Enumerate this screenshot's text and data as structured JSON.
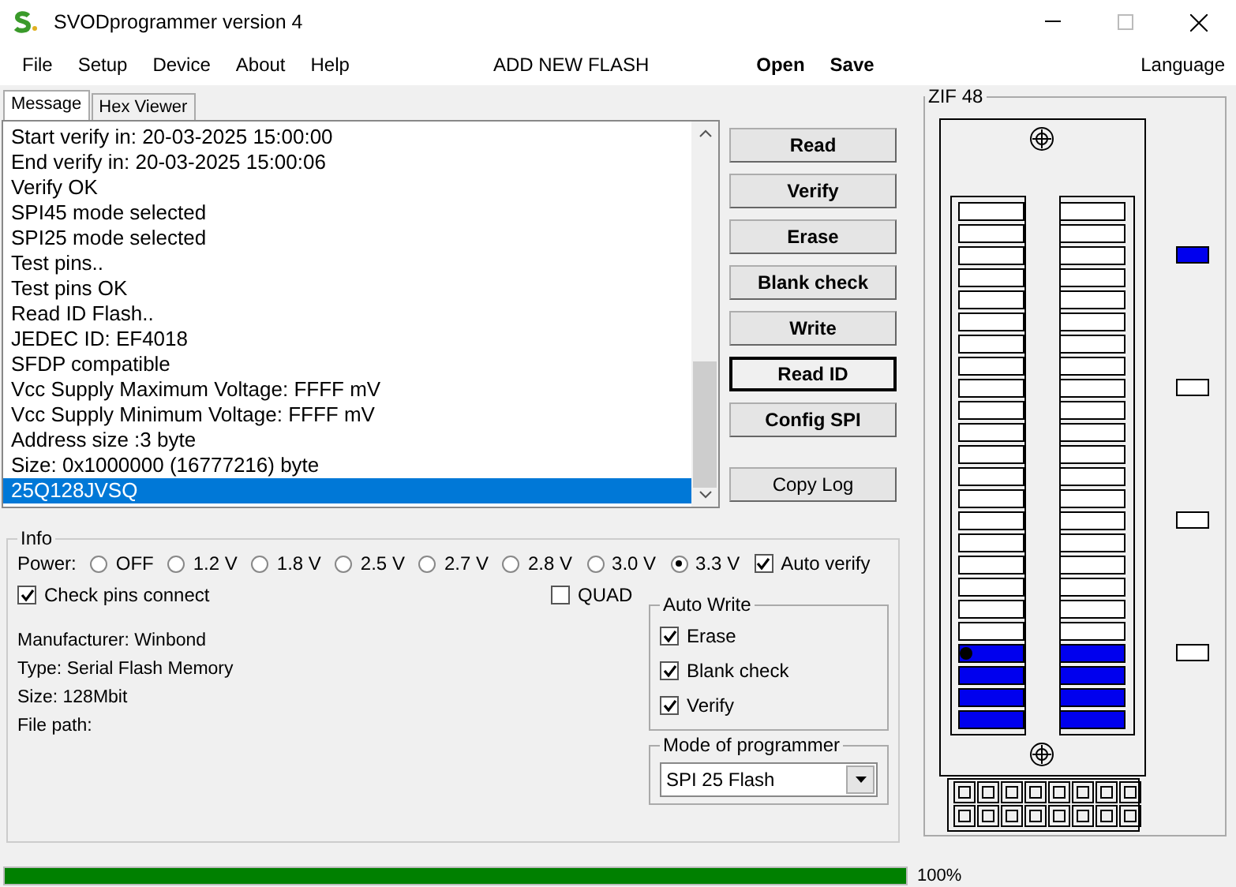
{
  "window": {
    "title": "SVODprogrammer version 4"
  },
  "menu": [
    {
      "label": "File"
    },
    {
      "label": "Setup"
    },
    {
      "label": "Device"
    },
    {
      "label": "About"
    },
    {
      "label": "Help"
    }
  ],
  "toolbar": {
    "add_flash": "ADD NEW FLASH",
    "open": "Open",
    "save": "Save",
    "language": "Language"
  },
  "tabs": [
    {
      "label": "Message",
      "selected": true
    },
    {
      "label": "Hex Viewer",
      "selected": false
    }
  ],
  "log": [
    {
      "text": "Start verify in: 20-03-2025 15:00:00",
      "selected": false
    },
    {
      "text": "End verify in: 20-03-2025 15:00:06",
      "selected": false
    },
    {
      "text": "Verify OK",
      "selected": false
    },
    {
      "text": "SPI45 mode selected",
      "selected": false
    },
    {
      "text": "SPI25 mode selected",
      "selected": false
    },
    {
      "text": "Test pins..",
      "selected": false
    },
    {
      "text": "Test pins OK",
      "selected": false
    },
    {
      "text": "Read ID Flash..",
      "selected": false
    },
    {
      "text": "JEDEC ID: EF4018",
      "selected": false
    },
    {
      "text": "SFDP compatible",
      "selected": false
    },
    {
      "text": "Vcc Supply Maximum Voltage: FFFF mV",
      "selected": false
    },
    {
      "text": "Vcc Supply Minimum Voltage: FFFF mV",
      "selected": false
    },
    {
      "text": "Address size :3 byte",
      "selected": false
    },
    {
      "text": "Size: 0x1000000 (16777216) byte",
      "selected": false
    },
    {
      "text": "25Q128JVSQ",
      "selected": true
    }
  ],
  "buttons": [
    {
      "label": "Read",
      "kind": "action",
      "focused": false
    },
    {
      "label": "Verify",
      "kind": "action",
      "focused": false
    },
    {
      "label": "Erase",
      "kind": "action",
      "focused": false
    },
    {
      "label": "Blank check",
      "kind": "action",
      "focused": false
    },
    {
      "label": "Write",
      "kind": "action",
      "focused": false
    },
    {
      "label": "Read ID",
      "kind": "action",
      "focused": true
    },
    {
      "label": "Config SPI",
      "kind": "action",
      "focused": false
    },
    {
      "label": "Copy Log",
      "kind": "utility",
      "focused": false
    }
  ],
  "info": {
    "title": "Info",
    "power_label": "Power:",
    "power": [
      {
        "label": "OFF",
        "selected": false
      },
      {
        "label": "1.2 V",
        "selected": false
      },
      {
        "label": "1.8 V",
        "selected": false
      },
      {
        "label": "2.5 V",
        "selected": false
      },
      {
        "label": "2.7 V",
        "selected": false
      },
      {
        "label": "2.8 V",
        "selected": false
      },
      {
        "label": "3.0 V",
        "selected": false
      },
      {
        "label": "3.3 V",
        "selected": true
      }
    ],
    "auto_verify": {
      "label": "Auto verify",
      "checked": true
    },
    "check_pins": {
      "label": "Check pins connect",
      "checked": true
    },
    "quad": {
      "label": "QUAD",
      "checked": false
    },
    "details": [
      "Manufacturer: Winbond",
      "Type:  Serial Flash Memory",
      "Size: 128Mbit",
      "File path:"
    ],
    "auto_write": {
      "title": "Auto Write",
      "options": [
        {
          "label": "Erase",
          "checked": true
        },
        {
          "label": "Blank check",
          "checked": true
        },
        {
          "label": "Verify",
          "checked": true
        }
      ]
    },
    "mode": {
      "title": "Mode of programmer",
      "value": "SPI 25 Flash"
    }
  },
  "zif": {
    "title": "ZIF 48",
    "left_pins": [
      {
        "on": false
      },
      {
        "on": false
      },
      {
        "on": false
      },
      {
        "on": false
      },
      {
        "on": false
      },
      {
        "on": false
      },
      {
        "on": false
      },
      {
        "on": false
      },
      {
        "on": false
      },
      {
        "on": false
      },
      {
        "on": false
      },
      {
        "on": false
      },
      {
        "on": false
      },
      {
        "on": false
      },
      {
        "on": false
      },
      {
        "on": false
      },
      {
        "on": false
      },
      {
        "on": false
      },
      {
        "on": false
      },
      {
        "on": false
      },
      {
        "on": true
      },
      {
        "on": true
      },
      {
        "on": true
      },
      {
        "on": true
      }
    ],
    "right_pins": [
      {
        "on": false
      },
      {
        "on": false
      },
      {
        "on": false
      },
      {
        "on": false
      },
      {
        "on": false
      },
      {
        "on": false
      },
      {
        "on": false
      },
      {
        "on": false
      },
      {
        "on": false
      },
      {
        "on": false
      },
      {
        "on": false
      },
      {
        "on": false
      },
      {
        "on": false
      },
      {
        "on": false
      },
      {
        "on": false
      },
      {
        "on": false
      },
      {
        "on": false
      },
      {
        "on": false
      },
      {
        "on": false
      },
      {
        "on": false
      },
      {
        "on": true
      },
      {
        "on": true
      },
      {
        "on": true
      },
      {
        "on": true
      }
    ],
    "indicators": [
      {
        "on": true
      },
      {
        "on": false
      },
      {
        "on": false
      },
      {
        "on": false
      }
    ]
  },
  "progress": {
    "level": 1,
    "reading": "100%"
  }
}
